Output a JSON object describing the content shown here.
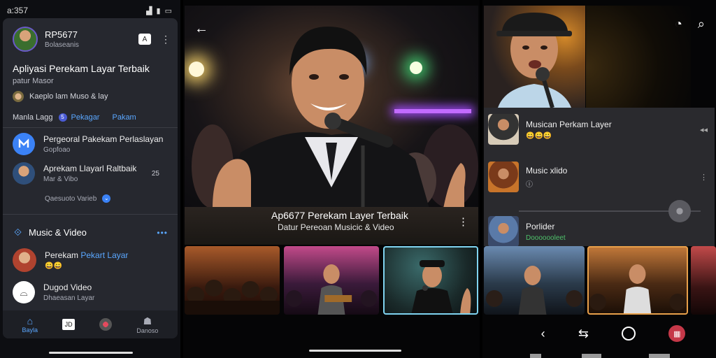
{
  "status_bar": {
    "time": "a:357"
  },
  "left_panel": {
    "account": {
      "name": "RP5677",
      "subtitle": "Bolaseanis",
      "button_label": "A"
    },
    "app_title": "Apliyasi Perekam Layar Terbaik",
    "app_subtitle": "patur Masor",
    "promo_row": {
      "text": "Kaeplo lam Muso & lay"
    },
    "meta_row": {
      "label": "Manla Lagg",
      "badge": "5",
      "link1": "Pekagar",
      "link2": "Pakam"
    },
    "list": [
      {
        "title": "Pergeoral Pakekam Perlaslayan",
        "subtitle": "Gopfoao",
        "icon": "app-logo-icon"
      },
      {
        "title": "Aprekam Llayarl Raltbaik",
        "subtitle": "Mar & Vibo",
        "meta": "25",
        "extra": "Qaesuoto Varieb"
      }
    ],
    "section": {
      "title": "Music & Video",
      "more": "•••"
    },
    "section_items": [
      {
        "title": "Perekam",
        "title_accent": "Pekart Layar",
        "emoji": "😀😀"
      },
      {
        "title": "Dugod Video",
        "subtitle": "Dhaeasan Layar"
      }
    ],
    "bottom_nav": [
      {
        "label": "Bayla",
        "icon": "home-icon",
        "active": true
      },
      {
        "label": "JD",
        "icon": "square-icon",
        "active": false
      },
      {
        "label": "",
        "icon": "record-icon",
        "active": false
      },
      {
        "label": "Danoso",
        "icon": "people-icon",
        "active": false
      }
    ]
  },
  "middle_panel": {
    "caption_title": "Ap6677 Perekam Layer Terbaik",
    "caption_subtitle": "Datur Pereoan Musicic & Video"
  },
  "right_panel": {
    "list": [
      {
        "title": "Musican Perkam Layer",
        "subtitle": "😀😀😀",
        "meta": "◂◂",
        "sub_style": "emoji"
      },
      {
        "title": "Music xlido",
        "subtitle": "ⓘ",
        "meta": "⋮",
        "sub_style": "plain"
      },
      {
        "title": "Porlider",
        "subtitle": "Dooooooleet",
        "meta": "",
        "sub_style": "green"
      }
    ]
  },
  "colors": {
    "accent": "#5aa7ff",
    "card_bg": "#26282f",
    "record": "#c53848",
    "selected_outline": "#7fd3f0"
  }
}
